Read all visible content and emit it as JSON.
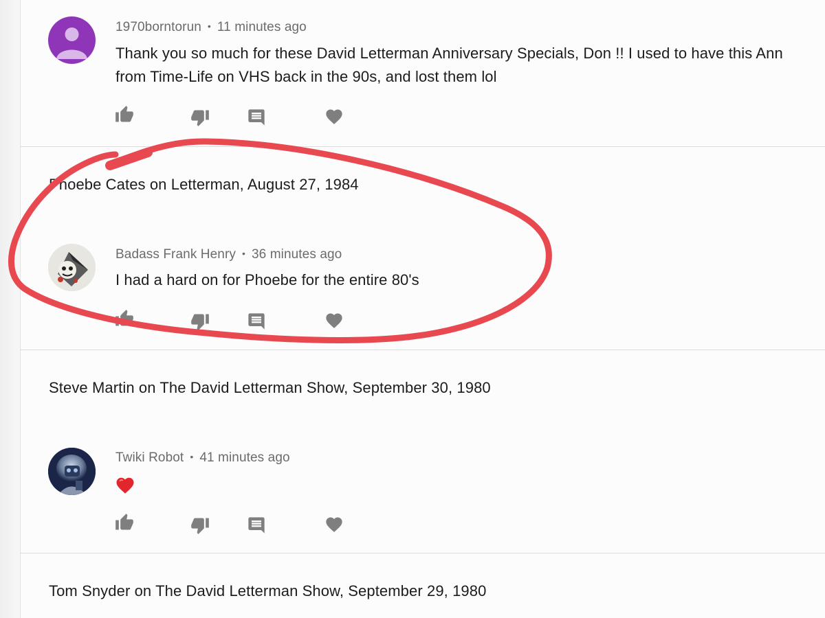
{
  "comments": [
    {
      "author": "1970borntorun",
      "time": "11 minutes ago",
      "lines": [
        "Thank you so much for these David Letterman Anniversary Specials, Don !! I used to have this Ann",
        "from Time-Life on VHS back in the 90s, and lost them lol"
      ]
    },
    {
      "video_title": "Phoebe Cates on Letterman, August 27, 1984",
      "author": "Badass Frank Henry",
      "time": "36 minutes ago",
      "lines": [
        "I had a hard on for Phoebe for the entire 80's"
      ]
    },
    {
      "video_title": "Steve Martin on The David Letterman Show, September 30, 1980",
      "author": "Twiki Robot",
      "time": "41 minutes ago",
      "emoji": "red-heart"
    },
    {
      "video_title": "Tom Snyder on The David Letterman Show, September 29, 1980"
    }
  ],
  "action_icons": [
    "thumbs-up-icon",
    "thumbs-down-icon",
    "reply-icon",
    "heart-icon"
  ],
  "colors": {
    "annotation": "#e8484f",
    "icon": "#7f7f7f",
    "avatar_purple": "#8e35b8"
  }
}
